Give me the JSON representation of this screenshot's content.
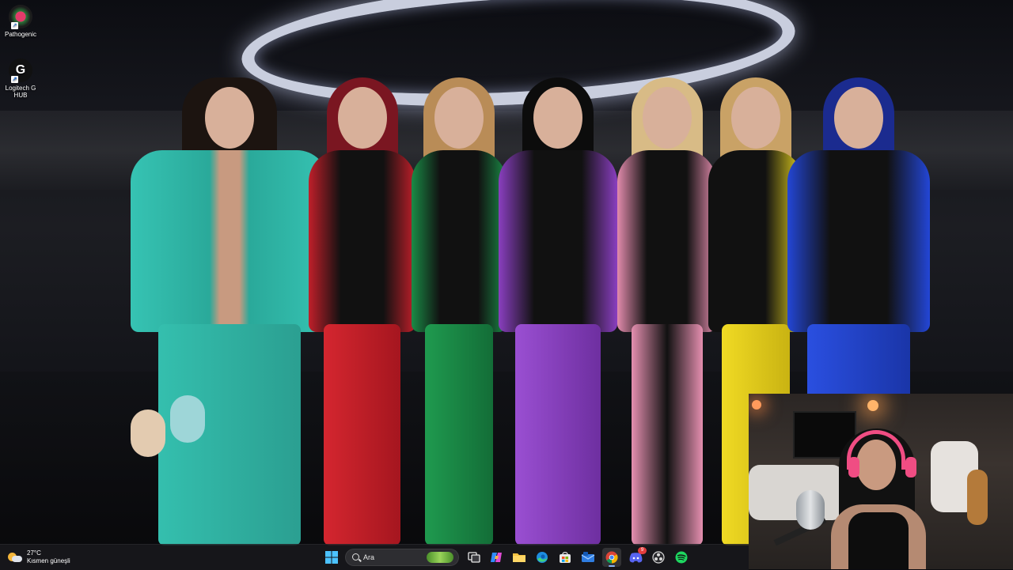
{
  "desktop": {
    "icons": [
      {
        "label": "Pathogenic",
        "icon": "pathogenic-app-icon"
      },
      {
        "label": "Logitech G HUB",
        "icon": "logitech-g-hub-icon"
      }
    ]
  },
  "wallpaper": {
    "description_icon": "group-photo-wallpaper"
  },
  "webcam": {
    "icon": "webcam-overlay"
  },
  "taskbar": {
    "weather": {
      "temperature": "27°C",
      "condition": "Kısmen güneşli"
    },
    "search": {
      "placeholder": "Ara"
    },
    "items": [
      {
        "name": "start-button",
        "icon": "windows-logo-icon"
      },
      {
        "name": "task-view",
        "icon": "task-view-icon"
      },
      {
        "name": "copilot",
        "icon": "copilot-icon"
      },
      {
        "name": "file-explorer",
        "icon": "folder-icon"
      },
      {
        "name": "edge",
        "icon": "edge-icon"
      },
      {
        "name": "microsoft-store",
        "icon": "store-icon"
      },
      {
        "name": "mail",
        "icon": "mail-icon"
      },
      {
        "name": "chrome",
        "icon": "chrome-icon",
        "active": true
      },
      {
        "name": "discord",
        "icon": "discord-icon",
        "badge": "9"
      },
      {
        "name": "obs",
        "icon": "obs-icon"
      },
      {
        "name": "spotify",
        "icon": "spotify-icon"
      }
    ]
  },
  "colors": {
    "taskbar_bg": "#18181c",
    "accent": "#8ab4f8",
    "spotify": "#1ed760",
    "discord": "#5865f2"
  }
}
